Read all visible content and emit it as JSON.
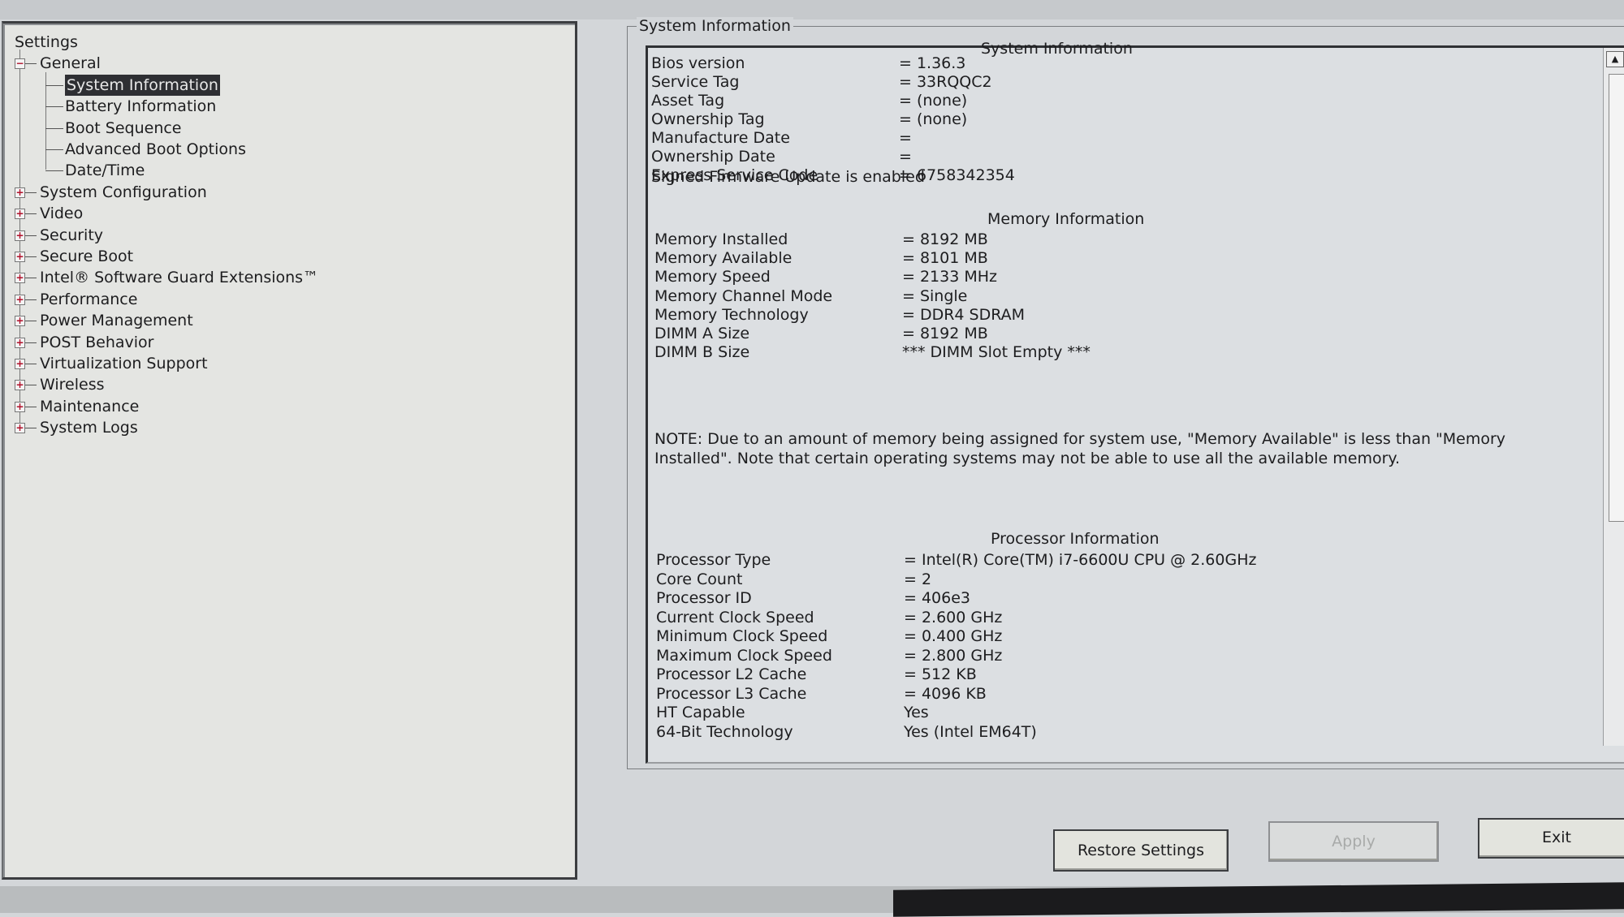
{
  "tree": {
    "root": "Settings",
    "expanded": {
      "label": "General",
      "children": [
        "System Information",
        "Battery Information",
        "Boot Sequence",
        "Advanced Boot Options",
        "Date/Time"
      ],
      "selected_index": 0
    },
    "collapsed": [
      "System Configuration",
      "Video",
      "Security",
      "Secure Boot",
      "Intel® Software Guard Extensions™",
      "Performance",
      "Power Management",
      "POST Behavior",
      "Virtualization Support",
      "Wireless",
      "Maintenance",
      "System Logs"
    ]
  },
  "group_title": "System Information",
  "system": {
    "header": "System Information",
    "rows": [
      {
        "k": "Bios version",
        "v": "= 1.36.3"
      },
      {
        "k": "Service Tag",
        "v": "= 33RQQC2"
      },
      {
        "k": "Asset Tag",
        "v": "= (none)"
      },
      {
        "k": "Ownership Tag",
        "v": "= (none)"
      },
      {
        "k": "Manufacture Date",
        "v": "="
      },
      {
        "k": "Ownership Date",
        "v": "="
      },
      {
        "k": "Express Service Code",
        "v": "= 6758342354"
      }
    ],
    "firmware_status": "Signed Firmware Update is enabled"
  },
  "memory": {
    "header": "Memory Information",
    "rows": [
      {
        "k": "Memory Installed",
        "v": "= 8192 MB"
      },
      {
        "k": "Memory Available",
        "v": "= 8101 MB"
      },
      {
        "k": "Memory Speed",
        "v": "= 2133 MHz"
      },
      {
        "k": "Memory Channel Mode",
        "v": "= Single"
      },
      {
        "k": "Memory Technology",
        "v": "= DDR4 SDRAM"
      },
      {
        "k": "DIMM A Size",
        "v": "= 8192 MB"
      },
      {
        "k": "DIMM B Size",
        "v": "*** DIMM Slot Empty ***"
      }
    ],
    "note": "NOTE: Due to an amount of memory being assigned for system use, \"Memory Available\" is less than \"Memory Installed\". Note that certain operating systems may not be able to use all the available memory."
  },
  "processor": {
    "header": "Processor Information",
    "rows": [
      {
        "k": "Processor Type",
        "v": "= Intel(R) Core(TM) i7-6600U CPU @ 2.60GHz"
      },
      {
        "k": "Core Count",
        "v": "= 2"
      },
      {
        "k": "Processor ID",
        "v": "= 406e3"
      },
      {
        "k": "Current Clock Speed",
        "v": "= 2.600 GHz"
      },
      {
        "k": "Minimum Clock Speed",
        "v": "= 0.400 GHz"
      },
      {
        "k": "Maximum Clock Speed",
        "v": "= 2.800 GHz"
      },
      {
        "k": "Processor L2 Cache",
        "v": "= 512 KB"
      },
      {
        "k": "Processor L3 Cache",
        "v": "= 4096 KB"
      },
      {
        "k": "HT Capable",
        "v": "Yes"
      },
      {
        "k": "64-Bit Technology",
        "v": "Yes (Intel EM64T)"
      }
    ]
  },
  "buttons": {
    "restore": "Restore Settings",
    "apply": "Apply",
    "exit": "Exit"
  },
  "colors": {
    "selection_bg": "#2e2f33",
    "expander_plus": "#b0102a"
  }
}
